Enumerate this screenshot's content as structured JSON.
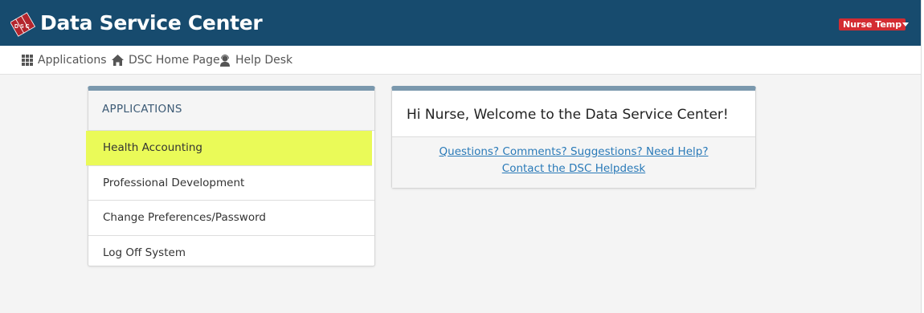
{
  "header": {
    "title": "Data Service Center",
    "logo_icon": "dsc-logo-icon",
    "logo_text": "DSC",
    "user_name": "Nurse Temp",
    "brand_color": "#174b6e",
    "badge_color": "#d32c32"
  },
  "nav": {
    "items": [
      {
        "label": "Applications",
        "icon": "grid-icon"
      },
      {
        "label": "DSC Home Page",
        "icon": "home-icon"
      },
      {
        "label": "Help Desk",
        "icon": "user-support-icon"
      }
    ]
  },
  "applications": {
    "header": "APPLICATIONS",
    "items": [
      {
        "label": "Health Accounting",
        "highlighted": true
      },
      {
        "label": "Professional Development"
      },
      {
        "label": "Change Preferences/Password"
      },
      {
        "label": "Log Off System"
      }
    ],
    "highlight_color": "#eafa58"
  },
  "welcome": {
    "title": "Hi Nurse, Welcome to the Data Service Center!",
    "help_link": "Questions? Comments? Suggestions? Need Help?",
    "contact_link": "Contact the DSC Helpdesk"
  }
}
